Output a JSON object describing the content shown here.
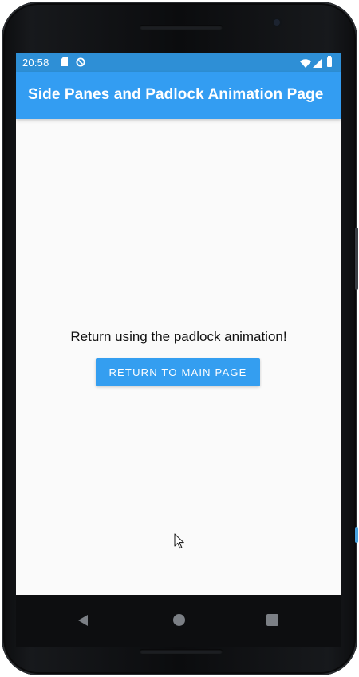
{
  "status_bar": {
    "time": "20:58",
    "left_icons": [
      "sd-card-icon",
      "sync-icon"
    ],
    "right_icons": [
      "wifi-icon",
      "signal-icon",
      "battery-icon"
    ]
  },
  "app_bar": {
    "title": "Side Panes and Padlock Animation Page"
  },
  "main": {
    "message": "Return using the padlock animation!",
    "return_button_label": "RETURN TO MAIN PAGE"
  },
  "nav_bar": {
    "icons": [
      "back-icon",
      "home-icon",
      "recents-icon"
    ]
  },
  "colors": {
    "status_bar": "#2E8FD6",
    "app_bar": "#339DF2",
    "button": "#349EF0",
    "background": "#FAFAFA",
    "nav_bar": "#0D0E10"
  }
}
